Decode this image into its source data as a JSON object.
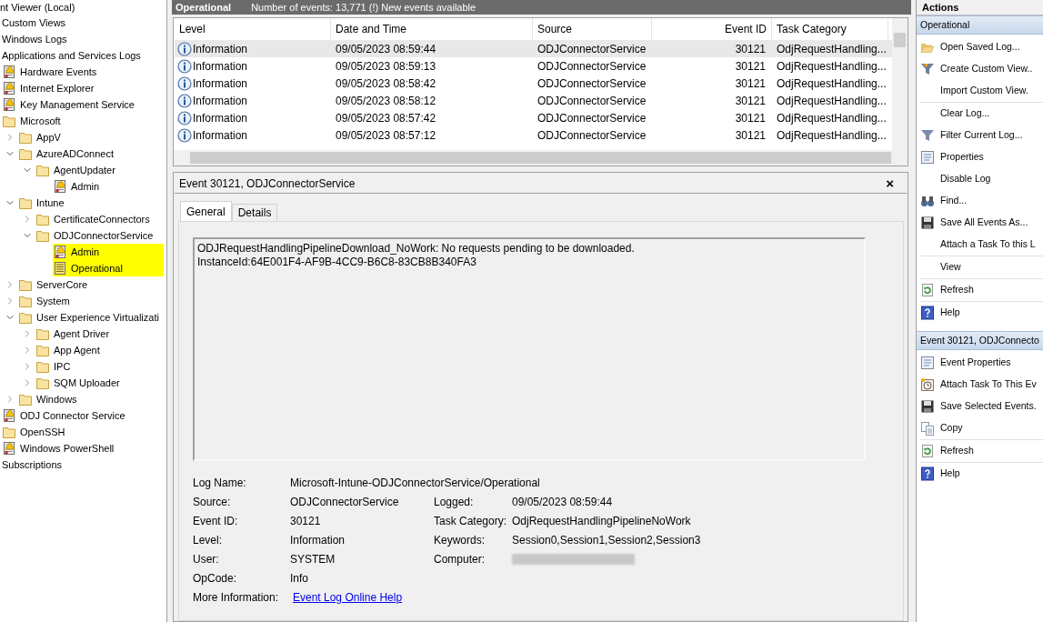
{
  "tree": {
    "root": "nt Viewer (Local)",
    "items": [
      {
        "label": "Custom Views",
        "kind": "none"
      },
      {
        "label": "Windows Logs",
        "kind": "none"
      },
      {
        "label": "Applications and Services Logs",
        "kind": "none",
        "children": [
          {
            "label": "Hardware Events",
            "kind": "log"
          },
          {
            "label": "Internet Explorer",
            "kind": "log"
          },
          {
            "label": "Key Management Service",
            "kind": "log"
          },
          {
            "label": "Microsoft",
            "kind": "folder",
            "children": [
              {
                "label": "AppV",
                "kind": "folder",
                "expanded": false
              },
              {
                "label": "AzureADConnect",
                "kind": "folder",
                "expanded": true,
                "children": [
                  {
                    "label": "AgentUpdater",
                    "kind": "folder",
                    "expanded": true,
                    "children": [
                      {
                        "label": "Admin",
                        "kind": "log"
                      }
                    ]
                  }
                ]
              },
              {
                "label": "Intune",
                "kind": "folder",
                "expanded": true,
                "children": [
                  {
                    "label": "CertificateConnectors",
                    "kind": "folder",
                    "expanded": false
                  },
                  {
                    "label": "ODJConnectorService",
                    "kind": "folder",
                    "expanded": true,
                    "children": [
                      {
                        "label": "Admin",
                        "kind": "log",
                        "highlighted": true
                      },
                      {
                        "label": "Operational",
                        "kind": "log-plain",
                        "highlighted": true
                      }
                    ]
                  }
                ]
              },
              {
                "label": "ServerCore",
                "kind": "folder",
                "expanded": false
              },
              {
                "label": "System",
                "kind": "folder",
                "expanded": false
              },
              {
                "label": "User Experience Virtualizati",
                "kind": "folder",
                "expanded": true,
                "children": [
                  {
                    "label": "Agent Driver",
                    "kind": "folder",
                    "expanded": false
                  },
                  {
                    "label": "App Agent",
                    "kind": "folder",
                    "expanded": false
                  },
                  {
                    "label": "IPC",
                    "kind": "folder",
                    "expanded": false
                  },
                  {
                    "label": "SQM Uploader",
                    "kind": "folder",
                    "expanded": false
                  }
                ]
              },
              {
                "label": "Windows",
                "kind": "folder",
                "expanded": false
              }
            ]
          },
          {
            "label": "ODJ Connector Service",
            "kind": "log"
          },
          {
            "label": "OpenSSH",
            "kind": "folder"
          },
          {
            "label": "Windows PowerShell",
            "kind": "log"
          }
        ]
      },
      {
        "label": "Subscriptions",
        "kind": "none"
      }
    ]
  },
  "log_header": {
    "title": "Operational",
    "summary": "Number of events: 13,771 (!) New events available"
  },
  "table": {
    "columns": [
      "Level",
      "Date and Time",
      "Source",
      "Event ID",
      "Task Category"
    ],
    "rows": [
      {
        "selected": true,
        "cells": [
          "Information",
          "09/05/2023 08:59:44",
          "ODJConnectorService",
          "30121",
          "OdjRequestHandling..."
        ]
      },
      {
        "selected": false,
        "cells": [
          "Information",
          "09/05/2023 08:59:13",
          "ODJConnectorService",
          "30121",
          "OdjRequestHandling..."
        ]
      },
      {
        "selected": false,
        "cells": [
          "Information",
          "09/05/2023 08:58:42",
          "ODJConnectorService",
          "30121",
          "OdjRequestHandling..."
        ]
      },
      {
        "selected": false,
        "cells": [
          "Information",
          "09/05/2023 08:58:12",
          "ODJConnectorService",
          "30121",
          "OdjRequestHandling..."
        ]
      },
      {
        "selected": false,
        "cells": [
          "Information",
          "09/05/2023 08:57:42",
          "ODJConnectorService",
          "30121",
          "OdjRequestHandling..."
        ]
      },
      {
        "selected": false,
        "cells": [
          "Information",
          "09/05/2023 08:57:12",
          "ODJConnectorService",
          "30121",
          "OdjRequestHandling..."
        ]
      }
    ]
  },
  "event": {
    "title": "Event 30121, ODJConnectorService",
    "close": "×",
    "tabs": [
      {
        "label": "General",
        "selected": true
      },
      {
        "label": "Details",
        "selected": false
      }
    ],
    "message": [
      "ODJRequestHandlingPipelineDownload_NoWork: No requests pending to be downloaded.",
      "InstanceId:64E001F4-AF9B-4CC9-B6C8-83CB8B340FA3"
    ],
    "log_name": {
      "label": "Log Name:",
      "value": "Microsoft-Intune-ODJConnectorService/Operational"
    },
    "fields": [
      [
        {
          "label": "Source:",
          "value": "ODJConnectorService"
        },
        {
          "label": "Logged:",
          "value": "09/05/2023 08:59:44"
        }
      ],
      [
        {
          "label": "Event ID:",
          "value": "30121"
        },
        {
          "label": "Task Category:",
          "value": "OdjRequestHandlingPipelineNoWork"
        }
      ],
      [
        {
          "label": "Level:",
          "value": "Information"
        },
        {
          "label": "Keywords:",
          "value": "Session0,Session1,Session2,Session3"
        }
      ],
      [
        {
          "label": "User:",
          "value": "SYSTEM"
        },
        {
          "label": "Computer:",
          "kind": "redacted"
        }
      ],
      [
        {
          "label": "OpCode:",
          "value": "Info"
        }
      ]
    ],
    "more_info": {
      "label": "More Information:",
      "link": "Event Log Online Help"
    }
  },
  "actions": {
    "title": "Actions",
    "sections": [
      {
        "title": "Operational",
        "groups": [
          [
            "Open Saved Log...",
            "Create Custom View..",
            "Import Custom View."
          ],
          [
            "Clear Log...",
            "Filter Current Log...",
            "Properties",
            "Disable Log",
            "Find...",
            "Save All Events As...",
            "Attach a Task To this L"
          ],
          [
            "View"
          ],
          [
            "Refresh"
          ],
          [
            "Help"
          ]
        ]
      },
      {
        "title": "Event 30121, ODJConnecto",
        "groups": [
          [
            "Event Properties",
            "Attach Task To This Ev",
            "Save Selected Events.",
            "Copy"
          ],
          [
            "Refresh"
          ],
          [
            "Help"
          ]
        ]
      }
    ]
  }
}
